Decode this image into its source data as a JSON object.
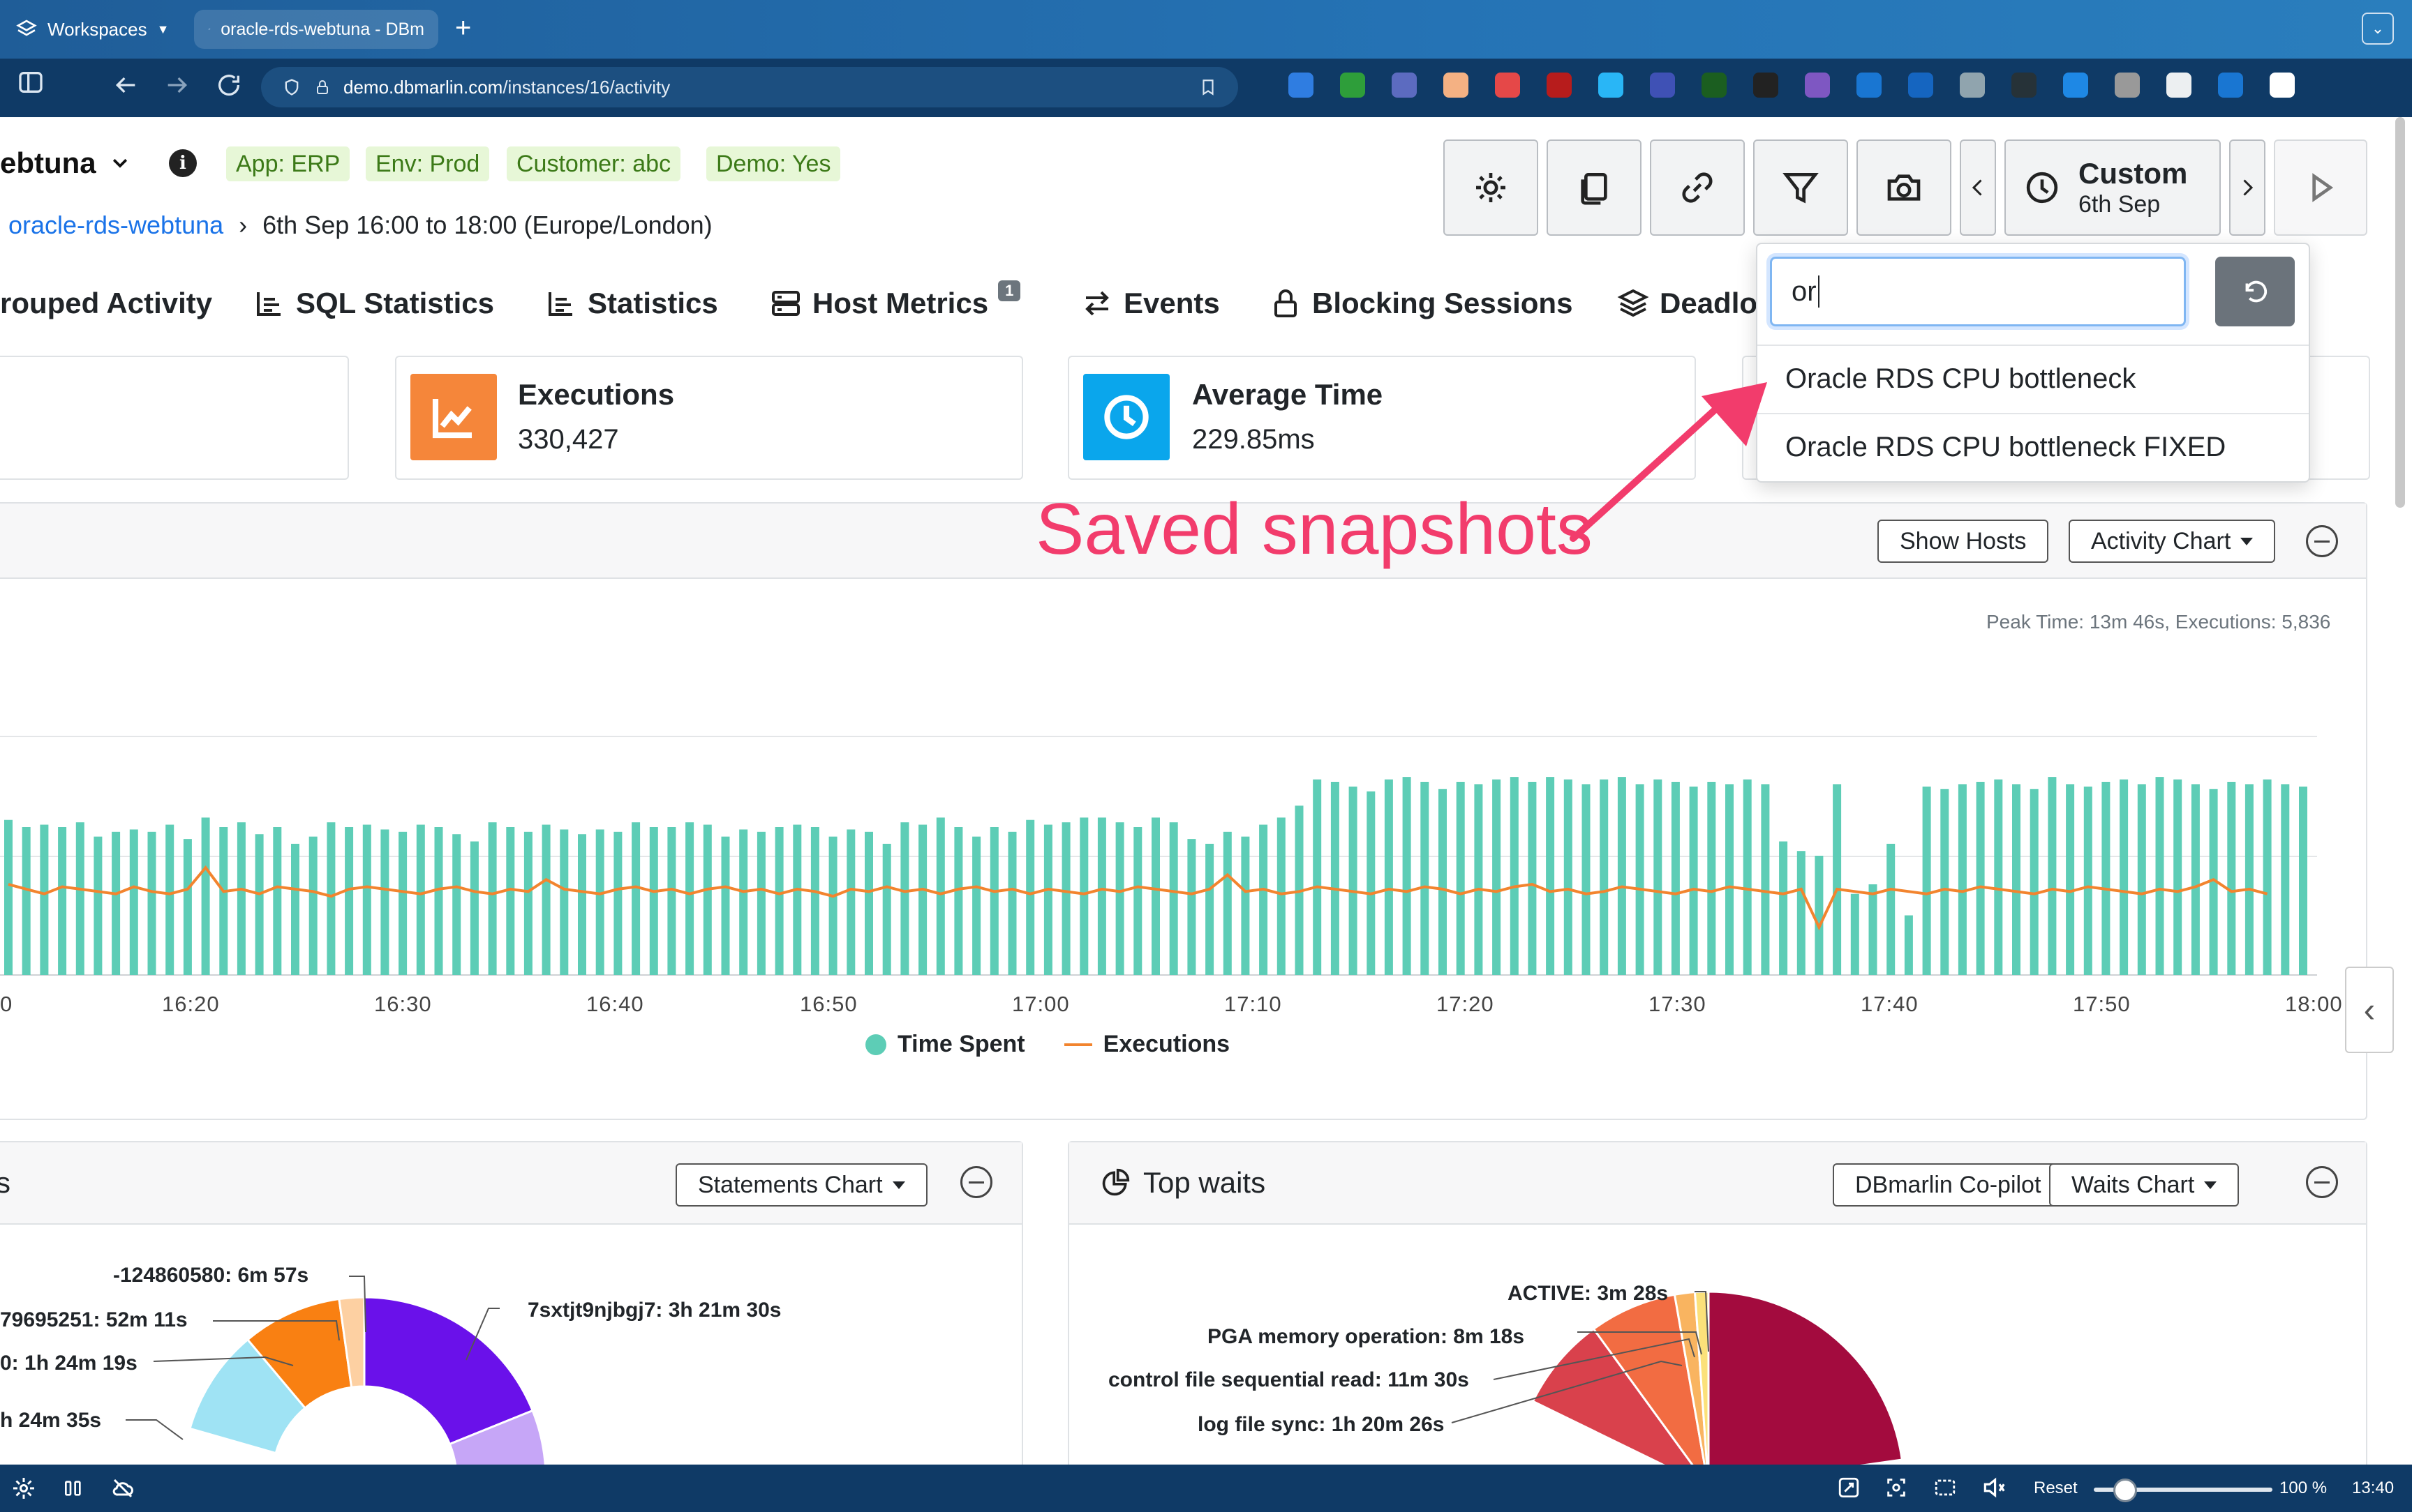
{
  "browser": {
    "workspaces_label": "Workspaces",
    "tab_title": "oracle-rds-webtuna - DBm",
    "url_host": "demo.dbmarlin.com",
    "url_path": "/instances/16/activity"
  },
  "header": {
    "instance_name": "ebtuna",
    "tags": [
      "App: ERP",
      "Env: Prod",
      "Customer: abc",
      "Demo: Yes"
    ],
    "breadcrumb_link": "oracle-rds-webtuna",
    "breadcrumb_sep": "›",
    "time_range": "6th Sep 16:00 to 18:00 (Europe/London)"
  },
  "toolbar": {
    "custom_label": "Custom",
    "custom_date": "6th Sep"
  },
  "nav_tabs": [
    {
      "label": "rouped Activity",
      "icon": "grouped-icon"
    },
    {
      "label": "SQL Statistics",
      "icon": "list-icon"
    },
    {
      "label": "Statistics",
      "icon": "list-icon"
    },
    {
      "label": "Host Metrics",
      "icon": "server-icon",
      "badge": "1"
    },
    {
      "label": "Events",
      "icon": "arrows-icon"
    },
    {
      "label": "Blocking Sessions",
      "icon": "lock-icon"
    },
    {
      "label": "Deadlo",
      "icon": "layers-icon"
    }
  ],
  "cards": {
    "executions": {
      "title": "Executions",
      "value": "330,427",
      "color": "#f5863a"
    },
    "average_time": {
      "title": "Average Time",
      "value": "229.85ms",
      "color": "#0aa6ec"
    }
  },
  "activity_panel": {
    "show_hosts": "Show Hosts",
    "chart_select": "Activity Chart",
    "peak_text": "Peak Time: 13m 46s, Executions: 5,836",
    "legend_time": "Time Spent",
    "legend_exec": "Executions",
    "bar_color": "#5dcdb6",
    "line_color": "#f2842e"
  },
  "chart_data": {
    "type": "bar",
    "x_ticks": [
      "0",
      "16:20",
      "16:30",
      "16:40",
      "16:50",
      "17:00",
      "17:10",
      "17:20",
      "17:30",
      "17:40",
      "17:50",
      "18:00"
    ],
    "series": [
      {
        "name": "Time Spent",
        "type": "bar",
        "values": [
          0.65,
          0.62,
          0.63,
          0.62,
          0.64,
          0.58,
          0.6,
          0.61,
          0.6,
          0.63,
          0.57,
          0.66,
          0.62,
          0.64,
          0.59,
          0.62,
          0.55,
          0.58,
          0.64,
          0.62,
          0.63,
          0.61,
          0.6,
          0.63,
          0.62,
          0.59,
          0.56,
          0.64,
          0.62,
          0.6,
          0.63,
          0.61,
          0.59,
          0.61,
          0.6,
          0.64,
          0.62,
          0.62,
          0.64,
          0.63,
          0.58,
          0.61,
          0.6,
          0.62,
          0.63,
          0.62,
          0.58,
          0.61,
          0.6,
          0.55,
          0.64,
          0.63,
          0.66,
          0.62,
          0.58,
          0.62,
          0.6,
          0.65,
          0.63,
          0.64,
          0.66,
          0.66,
          0.64,
          0.62,
          0.66,
          0.64,
          0.57,
          0.55,
          0.6,
          0.58,
          0.63,
          0.66,
          0.71,
          0.82,
          0.81,
          0.79,
          0.77,
          0.82,
          0.83,
          0.81,
          0.78,
          0.81,
          0.8,
          0.82,
          0.83,
          0.81,
          0.83,
          0.82,
          0.8,
          0.82,
          0.83,
          0.8,
          0.82,
          0.81,
          0.79,
          0.81,
          0.8,
          0.82,
          0.8,
          0.56,
          0.52,
          0.5,
          0.8,
          0.34,
          0.38,
          0.55,
          0.25,
          0.79,
          0.78,
          0.8,
          0.81,
          0.82,
          0.8,
          0.78,
          0.83,
          0.8,
          0.79,
          0.81,
          0.82,
          0.8,
          0.83,
          0.82,
          0.8,
          0.78,
          0.81,
          0.8,
          0.82,
          0.8,
          0.79
        ]
      },
      {
        "name": "Executions",
        "type": "line",
        "values": [
          0.38,
          0.36,
          0.34,
          0.37,
          0.36,
          0.35,
          0.34,
          0.37,
          0.35,
          0.34,
          0.36,
          0.45,
          0.35,
          0.36,
          0.34,
          0.37,
          0.36,
          0.35,
          0.33,
          0.36,
          0.37,
          0.36,
          0.35,
          0.34,
          0.36,
          0.37,
          0.35,
          0.34,
          0.36,
          0.35,
          0.4,
          0.36,
          0.35,
          0.34,
          0.36,
          0.37,
          0.35,
          0.36,
          0.34,
          0.36,
          0.37,
          0.35,
          0.36,
          0.34,
          0.36,
          0.35,
          0.33,
          0.36,
          0.35,
          0.37,
          0.35,
          0.36,
          0.34,
          0.36,
          0.37,
          0.35,
          0.36,
          0.34,
          0.36,
          0.35,
          0.34,
          0.36,
          0.35,
          0.37,
          0.36,
          0.35,
          0.34,
          0.36,
          0.42,
          0.35,
          0.36,
          0.34,
          0.35,
          0.37,
          0.36,
          0.35,
          0.34,
          0.36,
          0.35,
          0.37,
          0.36,
          0.34,
          0.36,
          0.35,
          0.37,
          0.38,
          0.35,
          0.36,
          0.34,
          0.35,
          0.37,
          0.36,
          0.35,
          0.34,
          0.36,
          0.35,
          0.37,
          0.36,
          0.35,
          0.34,
          0.36,
          0.2,
          0.36,
          0.35,
          0.34,
          0.36,
          0.35,
          0.34,
          0.36,
          0.35,
          0.37,
          0.36,
          0.35,
          0.34,
          0.36,
          0.35,
          0.37,
          0.36,
          0.35,
          0.34,
          0.36,
          0.35,
          0.37,
          0.4,
          0.35,
          0.36,
          0.34
        ]
      }
    ],
    "y_scale": "relative (0-1, no axis labels shown)",
    "legend_position": "bottom-center"
  },
  "statements_panel": {
    "title": "s",
    "chart_select": "Statements Chart",
    "labels": [
      "-124860580: 6m 57s",
      "79695251: 52m 11s",
      "0: 1h 24m 19s",
      "h 24m 35s",
      "7sxtjt9njbgj7: 3h 21m 30s"
    ],
    "colors": [
      "#6a11ea",
      "#f98012",
      "#fdd0a2",
      "#9fe3f4",
      "#c6a6f7"
    ]
  },
  "waits_panel": {
    "title": "Top waits",
    "copilot": "DBmarlin Co-pilot",
    "chart_select": "Waits Chart",
    "labels": [
      "ACTIVE: 3m 28s",
      "PGA memory operation: 8m 18s",
      "control file sequential read: 11m 30s",
      "log file sync: 1h 20m 26s"
    ],
    "colors": [
      "#a30b3e",
      "#d9414c",
      "#f26c42",
      "#f9b460",
      "#fbe17a"
    ]
  },
  "snapshot_dropdown": {
    "search_value": "or",
    "items": [
      "Oracle RDS CPU bottleneck",
      "Oracle RDS CPU bottleneck FIXED"
    ]
  },
  "annotation": {
    "text": "Saved snapshots",
    "color": "#f23c6c"
  },
  "statusbar": {
    "reset": "Reset",
    "zoom": "100 %",
    "time": "13:40"
  }
}
